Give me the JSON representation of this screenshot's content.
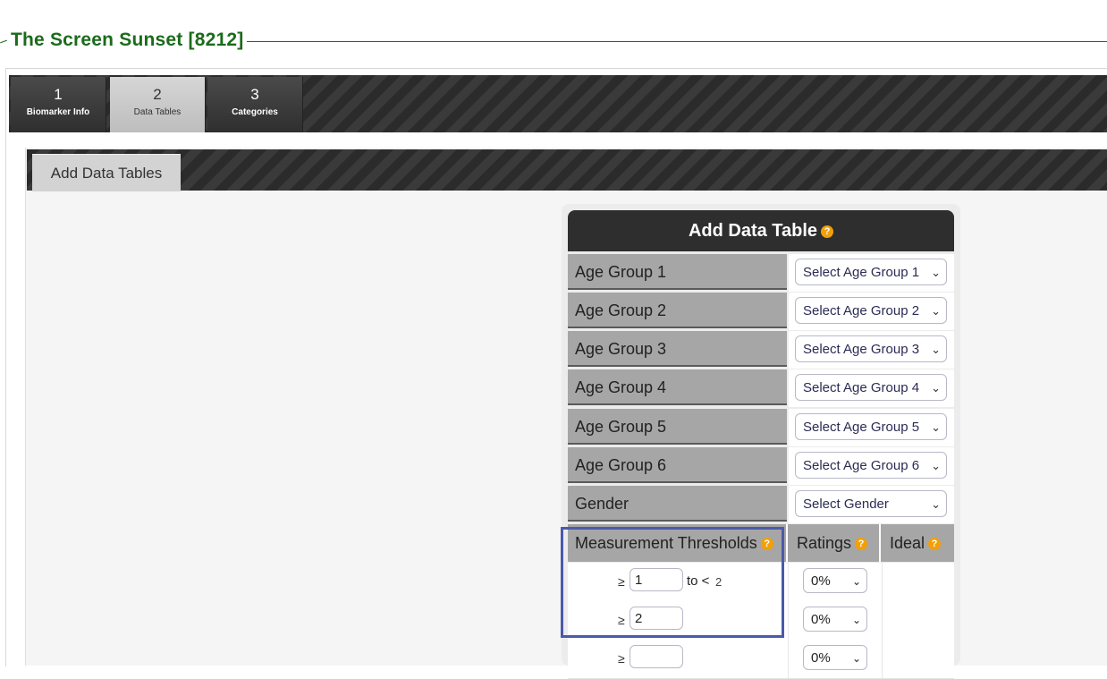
{
  "title": "The Screen Sunset [8212]",
  "steps": [
    {
      "num": "1",
      "label": "Biomarker Info"
    },
    {
      "num": "2",
      "label": "Data Tables"
    },
    {
      "num": "3",
      "label": "Categories"
    }
  ],
  "tab": "Add Data Tables",
  "panel": {
    "title": "Add Data Table",
    "help": "?",
    "rows": [
      {
        "label": "Age Group 1",
        "select": "Select Age Group 1"
      },
      {
        "label": "Age Group 2",
        "select": "Select Age Group 2"
      },
      {
        "label": "Age Group 3",
        "select": "Select Age Group 3"
      },
      {
        "label": "Age Group 4",
        "select": "Select Age Group 4"
      },
      {
        "label": "Age Group 5",
        "select": "Select Age Group 5"
      },
      {
        "label": "Age Group 6",
        "select": "Select Age Group 6"
      },
      {
        "label": "Gender",
        "select": "Select Gender"
      }
    ],
    "thresholds_header": {
      "measurement": "Measurement Thresholds",
      "ratings": "Ratings",
      "ideal": "Ideal"
    },
    "threshold_rows": [
      {
        "ge": "≥",
        "value": "1",
        "to": "to <",
        "upper": "2",
        "rating": "0%"
      },
      {
        "ge": "≥",
        "value": "2",
        "to": "",
        "upper": "",
        "rating": "0%"
      },
      {
        "ge": "≥",
        "value": "",
        "to": "",
        "upper": "",
        "rating": "0%"
      }
    ]
  },
  "icons": {
    "chevron": "chevron-down-icon",
    "help": "help-icon"
  },
  "colors": {
    "title_green": "#1b6b1b",
    "help_orange": "#f2a007",
    "highlight_blue": "#4a5bab"
  }
}
